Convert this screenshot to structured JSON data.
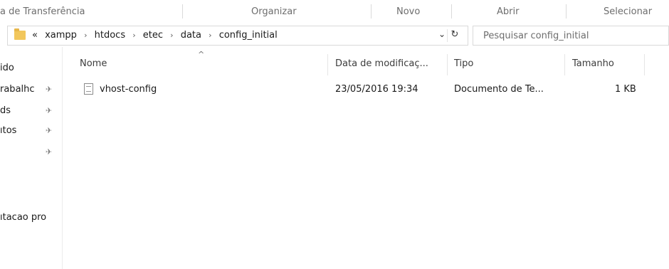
{
  "ribbon": {
    "groups": [
      "a de Transferência",
      "Organizar",
      "Novo",
      "Abrir",
      "Selecionar"
    ]
  },
  "address": {
    "overflow": "«",
    "crumbs": [
      "xampp",
      "htdocs",
      "etec",
      "data",
      "config_initial"
    ],
    "separator": "›",
    "dropdown_glyph": "⌄",
    "refresh_glyph": "↻"
  },
  "search": {
    "placeholder": "Pesquisar config_initial"
  },
  "nav": {
    "items": [
      {
        "label": "ido",
        "pinned": false
      },
      {
        "label": "rabalhc",
        "pinned": true
      },
      {
        "label": "ds",
        "pinned": true
      },
      {
        "label": "ıtos",
        "pinned": true
      },
      {
        "label": "",
        "pinned": true
      },
      {
        "label": "ıtacao pro",
        "pinned": false
      }
    ],
    "pin_glyph": "✈"
  },
  "table": {
    "sort_glyph": "^",
    "columns": [
      "Nome",
      "Data de modificaç...",
      "Tipo",
      "Tamanho"
    ],
    "rows": [
      {
        "icon": "text-file-icon",
        "name": "vhost-config",
        "modified": "23/05/2016 19:34",
        "type": "Documento de Te...",
        "size": "1 KB"
      }
    ]
  },
  "colors": {
    "folder": "#f2c75c",
    "muted_text": "#6d6d6d",
    "border": "#d9d9d9"
  }
}
